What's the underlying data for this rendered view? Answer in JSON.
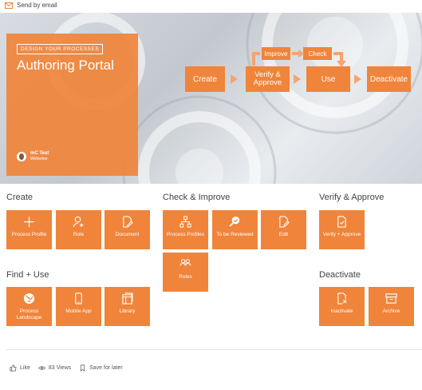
{
  "topbar": {
    "send_email": "Send by email"
  },
  "hero": {
    "tag": "DESIGN YOUR PROCESSES",
    "title": "Authoring Portal",
    "user_name": "mC Test",
    "user_org": "Wetterfee"
  },
  "flow": {
    "create": "Create",
    "verify": "Verify & Approve",
    "use": "Use",
    "deactivate": "Deactivate",
    "improve": "Improve",
    "check": "Check"
  },
  "sections": {
    "create": {
      "title": "Create",
      "tiles": [
        {
          "label": "Process Profile",
          "icon": "plus-icon"
        },
        {
          "label": "Role",
          "icon": "person-add-icon"
        },
        {
          "label": "Document",
          "icon": "document-edit-icon"
        }
      ]
    },
    "check": {
      "title": "Check & Improve",
      "tiles": [
        {
          "label": "Process Profiles",
          "icon": "hierarchy-icon"
        },
        {
          "label": "To be Reviewed",
          "icon": "search-check-icon"
        },
        {
          "label": "Edit",
          "icon": "document-edit-icon"
        },
        {
          "label": "Roles",
          "icon": "people-icon"
        }
      ]
    },
    "verify": {
      "title": "Verify & Approve",
      "tiles": [
        {
          "label": "Verify + Approve",
          "icon": "document-check-icon"
        }
      ]
    },
    "find": {
      "title": "Find + Use",
      "tiles": [
        {
          "label": "Process Landscape",
          "icon": "globe-icon"
        },
        {
          "label": "Mobile App",
          "icon": "mobile-icon"
        },
        {
          "label": "Library",
          "icon": "library-icon"
        }
      ]
    },
    "deactivate": {
      "title": "Deactivate",
      "tiles": [
        {
          "label": "Inactivate",
          "icon": "document-x-icon"
        },
        {
          "label": "Archive",
          "icon": "archive-icon"
        }
      ]
    }
  },
  "footer": {
    "like": "Like",
    "views": "83 Views",
    "save": "Save for later"
  },
  "colors": {
    "accent": "#f0843a",
    "accent_light": "#f4a471"
  }
}
